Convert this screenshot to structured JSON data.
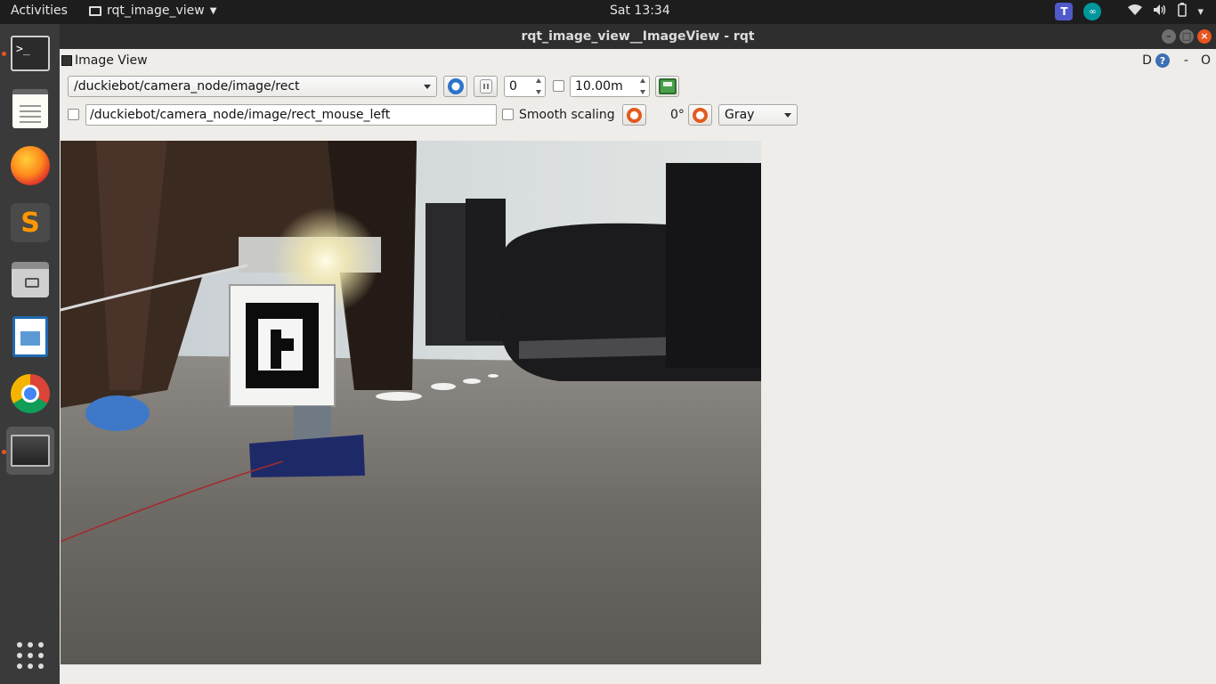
{
  "topbar": {
    "activities": "Activities",
    "app_name": "rqt_image_view",
    "clock": "Sat 13:34",
    "tray": {
      "teams_letter": "T",
      "arduino_symbol": "∞",
      "icons": [
        "teams-icon",
        "arduino-icon",
        "wifi-icon",
        "volume-icon",
        "battery-icon",
        "system-menu-icon"
      ]
    }
  },
  "dock": {
    "items": [
      "terminal",
      "text-editor",
      "firefox",
      "sublime-text",
      "files",
      "libreoffice-writer",
      "chrome",
      "rqt-image-view",
      "show-applications"
    ],
    "terminal_prompt": ">_",
    "sublime_letter": "S",
    "accent_color": "#e95420"
  },
  "window": {
    "title": "rqt_image_view__ImageView - rqt",
    "dock_widget_title": "Image View",
    "dock_controls": {
      "d_label": "D",
      "help_label": "?",
      "minimize_label": "-",
      "close_label": "O"
    }
  },
  "toolbar": {
    "topic": "/duckiebot/camera_node/image/rect",
    "frame_skip": "0",
    "max_range": "10.00m",
    "mouse_topic": "/duckiebot/camera_node/image/rect_mouse_left",
    "smooth_scaling_label": "Smooth scaling",
    "smooth_scaling_checked": false,
    "rotation": "0°",
    "color_scheme": "Gray"
  },
  "image": {
    "description_icon": "camera-frame"
  }
}
